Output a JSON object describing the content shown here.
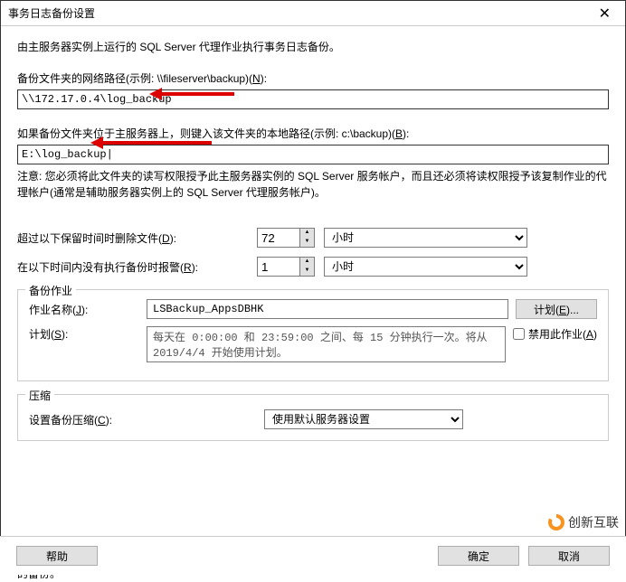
{
  "title": "事务日志备份设置",
  "intro": "由主服务器实例上运行的 SQL Server 代理作业执行事务日志备份。",
  "networkPath": {
    "label": "备份文件夹的网络路径(示例: \\\\fileserver\\backup)",
    "access": "N",
    "value": "\\\\172.17.0.4\\log_backup"
  },
  "localPath": {
    "label": "如果备份文件夹位于主服务器上，则键入该文件夹的本地路径(示例: c:\\backup)",
    "access": "B",
    "value": "E:\\log_backup|"
  },
  "localNote": "注意: 您必须将此文件夹的读写权限授予此主服务器实例的 SQL Server 服务帐户，而且还必须将读权限授予该复制作业的代理帐户(通常是辅助服务器实例上的 SQL Server 代理服务帐户)。",
  "deleteOlder": {
    "label": "超过以下保留时间时删除文件",
    "access": "D",
    "value": "72",
    "unit": "小时"
  },
  "alertNoBackup": {
    "label": "在以下时间内没有执行备份时报警",
    "access": "R",
    "value": "1",
    "unit": "小时"
  },
  "backupJob": {
    "legend": "备份作业",
    "jobNameLabel": "作业名称",
    "jobNameAccess": "J",
    "jobName": "LSBackup_AppsDBHK",
    "scheduleBtn": "计划",
    "scheduleBtnAccess": "E",
    "scheduleLabel": "计划",
    "scheduleAccess": "S",
    "scheduleText": "每天在 0:00:00 和 23:59:00 之间、每 15 分钟执行一次。将从 2019/4/4 开始使用计划。",
    "disableJob": "禁用此作业",
    "disableAccess": "A",
    "disabled": false
  },
  "compress": {
    "legend": "压缩",
    "label": "设置备份压缩",
    "access": "C",
    "value": "使用默认服务器设置"
  },
  "bottomNote": "注意: 如果您根据任何其他作业或维护计划备份此数据库的事务日志，则 Management Studio 将无法还原辅助服务器实例上的备份。",
  "footer": {
    "help": "帮助",
    "ok": "确定",
    "cancel": "取消"
  },
  "watermark": "创新互联"
}
